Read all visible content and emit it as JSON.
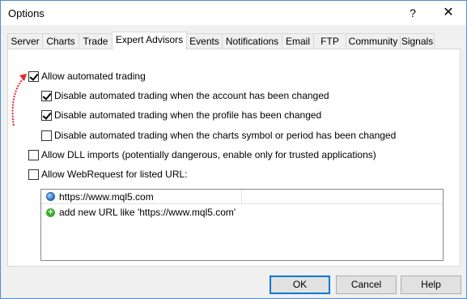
{
  "window": {
    "title": "Options",
    "help_glyph": "?",
    "close_glyph": "✕"
  },
  "tabs": [
    {
      "label": "Server"
    },
    {
      "label": "Charts"
    },
    {
      "label": "Trade"
    },
    {
      "label": "Expert Advisors",
      "active": true
    },
    {
      "label": "Events"
    },
    {
      "label": "Notifications"
    },
    {
      "label": "Email"
    },
    {
      "label": "FTP"
    },
    {
      "label": "Community"
    },
    {
      "label": "Signals"
    }
  ],
  "options": {
    "allow_automated_trading": {
      "label": "Allow automated trading",
      "checked": true
    },
    "disable_account_changed": {
      "label": "Disable automated trading when the account has been changed",
      "checked": true
    },
    "disable_profile_changed": {
      "label": "Disable automated trading when the profile has been changed",
      "checked": true
    },
    "disable_symbol_changed": {
      "label": "Disable automated trading when the charts symbol or period has been changed",
      "checked": false
    },
    "allow_dll_imports": {
      "label": "Allow DLL imports (potentially dangerous, enable only for trusted applications)",
      "checked": false
    },
    "allow_webrequest": {
      "label": "Allow WebRequest for listed URL:",
      "checked": false
    }
  },
  "url_list": {
    "items": [
      {
        "url": "https://www.mql5.com",
        "icon": "globe-icon"
      }
    ],
    "add_placeholder": "add new URL like 'https://www.mql5.com'",
    "add_icon": "plus-icon"
  },
  "buttons": {
    "ok": "OK",
    "cancel": "Cancel",
    "help": "Help"
  },
  "annotation": {
    "arrow_color": "#e8262b"
  }
}
